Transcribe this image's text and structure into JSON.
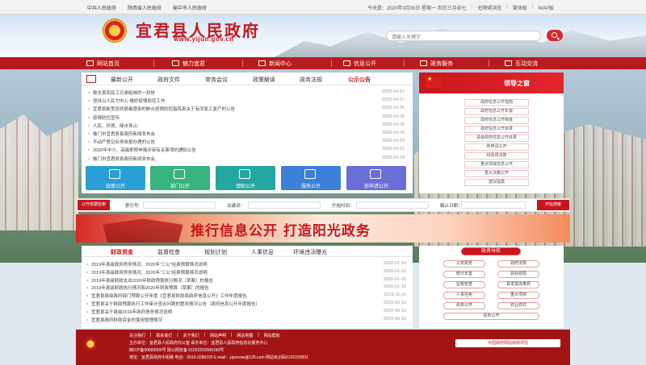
{
  "topbar": {
    "links": [
      "中共人民政府",
      "陕西省人民政府",
      "榆中市人民政府"
    ],
    "date": "今天是：2020年3月30日 星期一 农历三月初七",
    "right_links": [
      "无障碍浏览",
      "繁体版",
      "WAP版"
    ]
  },
  "header": {
    "title": "宜君县人民政府",
    "url": "www.yijun.gov.cn",
    "search_placeholder": "请输入关键字"
  },
  "nav": {
    "items": [
      "网站首页",
      "魅力宜君",
      "新闻中心",
      "信息公开",
      "政务服务",
      "互动交流"
    ]
  },
  "news": {
    "tabs": [
      "最新公开",
      "政府文件",
      "常务会议",
      "政策解读",
      "政务法规",
      "公示公告"
    ],
    "active_tab": "公示公告",
    "items": [
      {
        "title": "致全县农民工兄弟姐妹的一封信",
        "date": "2020-03-27"
      },
      {
        "title": "坚持以人民为中心 做好疫情防控工作",
        "date": "2020-03-27"
      },
      {
        "title": "宜君县新型冠状病毒感染的肺炎疫情防控指挥部关于有序复工复产的公告",
        "date": "2020-03-26"
      },
      {
        "title": "疫情防控宣传",
        "date": "2020-03-25"
      },
      {
        "title": "人民、环境、绿水青山",
        "date": "2020-03-25"
      },
      {
        "title": "榆门市宜君县县政府新闻发布会",
        "date": "2020-03-24"
      },
      {
        "title": "不动产登记业务恢复办理的公告",
        "date": "2020-03-23"
      },
      {
        "title": "2020年中小、高级职称申报评审有关事项的通知公告",
        "date": "2020-03-21"
      },
      {
        "title": "榆门市宜君县县政府新闻发布会",
        "date": "2020-03-18"
      }
    ],
    "quick": [
      "政策公开",
      "部门公开",
      "镇街公开",
      "服务公开",
      "依申请公开"
    ]
  },
  "leader": {
    "title": "领导之窗",
    "buttons": [
      "政府信息公开指南",
      "政府信息公开年报",
      "政府信息公开制度",
      "政府信息公开目录",
      "县级政府信息公开目录",
      "依申请公开",
      "财政预决算",
      "重点领域信息公开",
      "重大决策公开",
      "建议提案"
    ]
  },
  "search_bar": {
    "label": "公开依据检索",
    "fields": [
      "索引号：",
      "关键词：",
      "开始时间：",
      "截止日期："
    ],
    "button": "开始搜索"
  },
  "banner": {
    "slogan": "推行信息公开  打造阳光政务"
  },
  "lower": {
    "tabs": [
      "财政资金",
      "监督检查",
      "规划计划",
      "人事信息",
      "环境违法曝光"
    ],
    "active_tab": "财政资金",
    "items": [
      {
        "title": "2019年县级政府债务情况、2020年“三公”经费预算情况说明",
        "date": "2020-01-10"
      },
      {
        "title": "2019年县级政府债务情况、2020年“三公”经费预算情况说明",
        "date": "2020-01-10"
      },
      {
        "title": "2019年县级财政支出2020年财政预算执行情况（草案）的报告",
        "date": "2020-01-10"
      },
      {
        "title": "2019年县级财政执行情况和2020年财政预算（草案）的报告",
        "date": "2020-01-10"
      },
      {
        "title": "宜君县县级政府部门预算公开年度《宜君县财政局政府信息公开》工作年度报告",
        "date": "2019-11-21"
      },
      {
        "title": "宜君县关于财政预算执行工作审计查出问题的整改情况公告（政府信息公开年度报告）",
        "date": "2019-09-10"
      },
      {
        "title": "宜君县关于县级2019年政府债务情况说明",
        "date": "2019-06-10"
      },
      {
        "title": "宜君县政府财政资金的使用管理情况",
        "date": "2019-06-10"
      }
    ]
  },
  "guide": {
    "title": "政务导航",
    "buttons": [
      "公安政务",
      "政府法规",
      "统计年鉴",
      "县财政局",
      "监督检查",
      "县发展改革局",
      "人事任免",
      "重大项目",
      "政务公开",
      "农业农村",
      "县务公开"
    ]
  },
  "footer": {
    "nav": [
      "关注我们",
      "联系我们",
      "关于我们",
      "网站声明",
      "网站地图",
      "网站帮助"
    ],
    "lines": [
      "主办单位：宜君县人民政府办公室  承办单位：宜君县人民政府信息化服务中心",
      "陕ICP备00000000号  陕公网安备 61022202000169号",
      "地址：宜君县政府中街路   电话：0919-3286325   E-mail：yijuncow@126.com   网站标识码6102220001"
    ],
    "cert": "中国政府网站绩效评估"
  },
  "colors": {
    "brand_red": "#c8161d",
    "nav_red": "#b81b1e"
  }
}
